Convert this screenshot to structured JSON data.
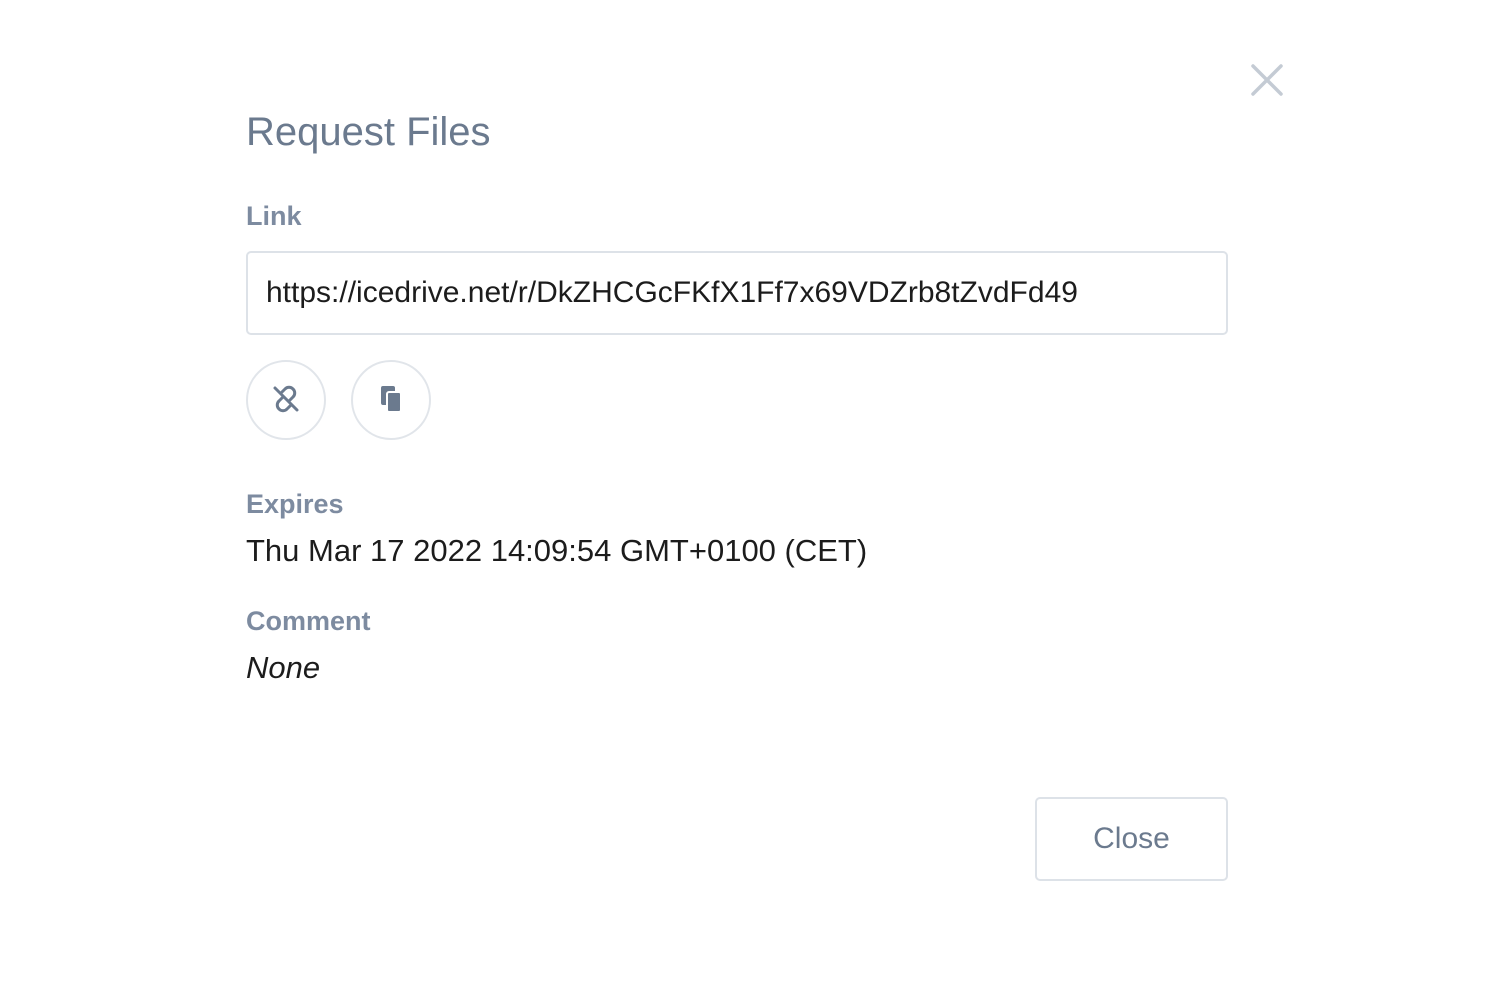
{
  "dialog": {
    "title": "Request Files",
    "close_icon": "close-icon",
    "link": {
      "label": "Link",
      "value": "https://icedrive.net/r/DkZHCGcFKfX1Ff7x69VDZrb8tZvdFd49"
    },
    "actions": [
      {
        "icon": "unlink-icon"
      },
      {
        "icon": "copy-icon"
      }
    ],
    "expires": {
      "label": "Expires",
      "value": "Thu Mar 17 2022 14:09:54 GMT+0100 (CET)"
    },
    "comment": {
      "label": "Comment",
      "value": "None"
    },
    "footer": {
      "close_label": "Close"
    }
  },
  "colors": {
    "title": "#6b7a8e",
    "label": "#7d8ba0",
    "border": "#dde2e8",
    "icon": "#6b7a8e",
    "text": "#1c1c1c"
  }
}
